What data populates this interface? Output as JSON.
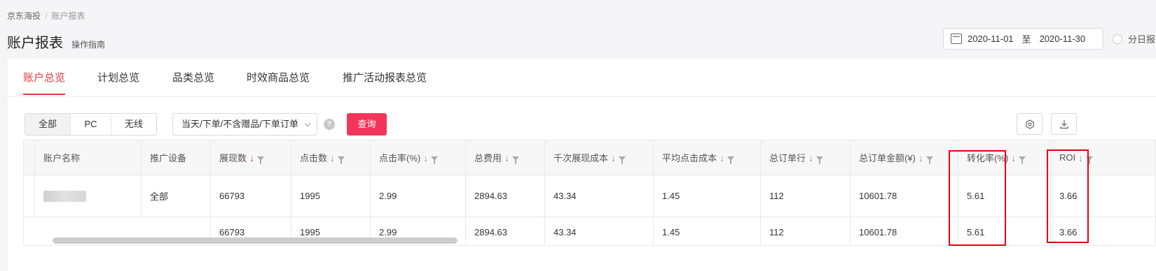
{
  "breadcrumb": {
    "root": "京东海投",
    "separator": "/",
    "current": "账户报表"
  },
  "header": {
    "title": "账户报表",
    "guide_link": "操作指南"
  },
  "date_range": {
    "start": "2020-11-01",
    "separator": "至",
    "end": "2020-11-30"
  },
  "daily_toggle": {
    "label": "分日报"
  },
  "tabs": [
    {
      "label": "账户总览",
      "active": true
    },
    {
      "label": "计划总览",
      "active": false
    },
    {
      "label": "品类总览",
      "active": false
    },
    {
      "label": "时效商品总览",
      "active": false
    },
    {
      "label": "推广活动报表总览",
      "active": false
    }
  ],
  "filters": {
    "device_segments": [
      {
        "label": "全部",
        "active": true
      },
      {
        "label": "PC",
        "active": false
      },
      {
        "label": "无线",
        "active": false
      }
    ],
    "order_type": {
      "value": "当天/下单/不含赠品/下单订单"
    },
    "help_icon": "?",
    "query_label": "查询"
  },
  "toolbar": {
    "settings_icon": "gear-icon",
    "download_icon": "download-icon"
  },
  "table": {
    "columns": [
      "账户名称",
      "推广设备",
      "展现数",
      "点击数",
      "点击率(%)",
      "总费用",
      "千次展现成本",
      "平均点击成本",
      "总订单行",
      "总订单金额(¥)",
      "转化率(%)",
      "ROI"
    ],
    "rows": [
      {
        "account": "",
        "device": "全部",
        "impressions": "66793",
        "clicks": "1995",
        "ctr": "2.99",
        "cost": "2894.63",
        "cpm": "43.34",
        "cpc": "1.45",
        "order_lines": "112",
        "order_amount": "10601.78",
        "conversion": "5.61",
        "roi": "3.66"
      },
      {
        "account": "",
        "device": "",
        "impressions": "66793",
        "clicks": "1995",
        "ctr": "2.99",
        "cost": "2894.63",
        "cpm": "43.34",
        "cpc": "1.45",
        "order_lines": "112",
        "order_amount": "10601.78",
        "conversion": "5.61",
        "roi": "3.66"
      }
    ]
  },
  "colors": {
    "accent": "#e4393c",
    "query_button": "#f2365b",
    "highlight_box": "#e60012"
  }
}
